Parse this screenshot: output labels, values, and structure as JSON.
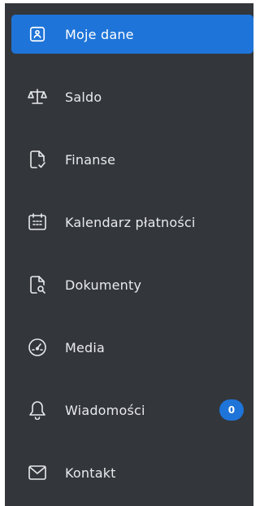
{
  "sidebar": {
    "items": [
      {
        "label": "Moje dane",
        "icon": "id-card-icon",
        "active": true
      },
      {
        "label": "Saldo",
        "icon": "scales-icon"
      },
      {
        "label": "Finanse",
        "icon": "document-check-icon"
      },
      {
        "label": "Kalendarz płatności",
        "icon": "calendar-icon"
      },
      {
        "label": "Dokumenty",
        "icon": "document-search-icon"
      },
      {
        "label": "Media",
        "icon": "gauge-icon"
      },
      {
        "label": "Wiadomości",
        "icon": "bell-icon",
        "badge": "0"
      },
      {
        "label": "Kontakt",
        "icon": "envelope-icon"
      }
    ]
  },
  "colors": {
    "sidebar_bg": "#33363b",
    "accent": "#1e74d8",
    "text": "#e9eaec"
  }
}
